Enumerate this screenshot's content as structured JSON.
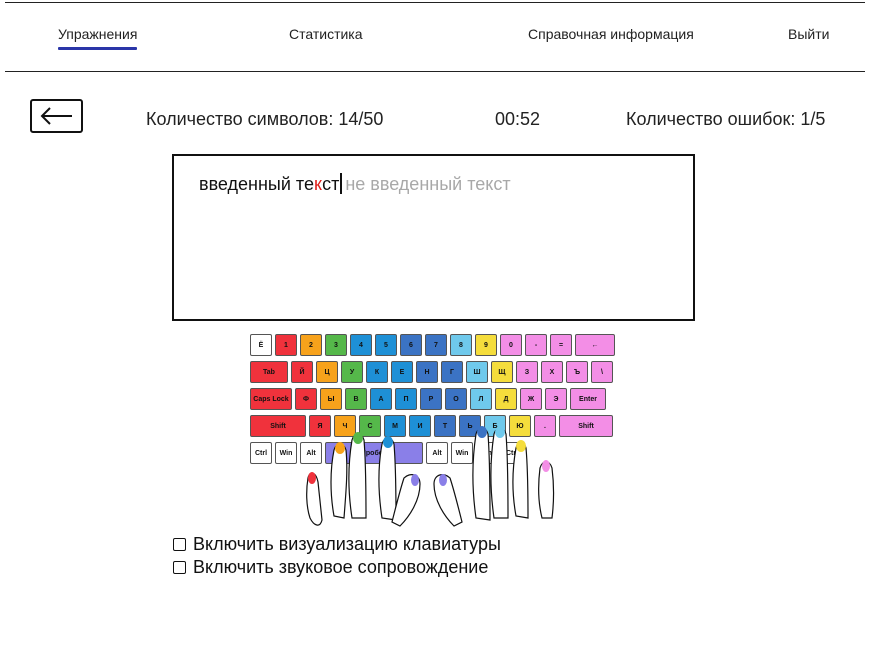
{
  "nav": {
    "exercises": "Упражнения",
    "statistics": "Статистика",
    "reference": "Справочная информация",
    "logout": "Выйти"
  },
  "status": {
    "symbols": "Количество символов: 14/50",
    "timer": "00:52",
    "errors": "Количество ошибок: 1/5"
  },
  "text": {
    "typed_before": "введенный те",
    "typed_error": "к",
    "typed_after": "ст",
    "pending": "не введенный текст"
  },
  "keyboard": {
    "rows": [
      [
        "Ё",
        "1",
        "2",
        "3",
        "4",
        "5",
        "6",
        "7",
        "8",
        "9",
        "0",
        "-",
        "=",
        "←"
      ],
      [
        "Tab",
        "Й",
        "Ц",
        "У",
        "К",
        "Е",
        "Н",
        "Г",
        "Ш",
        "Щ",
        "З",
        "Х",
        "Ъ",
        "\\"
      ],
      [
        "Caps Lock",
        "Ф",
        "Ы",
        "В",
        "А",
        "П",
        "Р",
        "О",
        "Л",
        "Д",
        "Ж",
        "Э",
        "Enter"
      ],
      [
        "Shift",
        "Я",
        "Ч",
        "С",
        "М",
        "И",
        "Т",
        "Ь",
        "Б",
        "Ю",
        ".",
        "Shift"
      ],
      [
        "Ctrl",
        "Win",
        "Alt",
        "Пробел",
        "Alt",
        "Win",
        "Menu",
        "Ctrl"
      ]
    ],
    "space_label": "Пробел"
  },
  "options": {
    "visualize": "Включить визуализацию клавиатуры",
    "sound": "Включить звуковое сопровождение"
  },
  "colors": {
    "accent": "#2a35a8",
    "error": "#e0201b",
    "pending": "#a8a8a8",
    "finger_pinky_left": "#f0323c",
    "finger_ring_left": "#f7a21b",
    "finger_middle_left": "#55b84a",
    "finger_index_left": "#1e90d6",
    "finger_index_left2": "#3b73c4",
    "finger_index_right": "#3b73c4",
    "finger_index_right2": "#6fc9ec",
    "finger_middle_right": "#f5dd3c",
    "finger_ring_right": "#f38ee6",
    "space": "#8a7fe8"
  }
}
